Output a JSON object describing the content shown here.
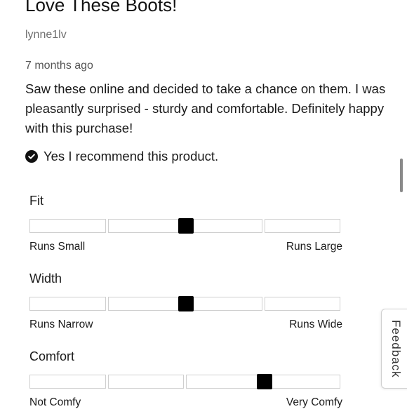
{
  "review": {
    "title": "Love These Boots!",
    "username": "lynne1lv",
    "timestamp": "7 months ago",
    "body": "Saw these online and decided to take a chance on them. I was pleasantly surprised - sturdy and comfortable. Definitely happy with this purchase!",
    "recommend_text": "Yes I recommend this product."
  },
  "ratings": [
    {
      "label": "Fit",
      "low": "Runs Small",
      "high": "Runs Large",
      "value_fraction": 0.5
    },
    {
      "label": "Width",
      "low": "Runs Narrow",
      "high": "Runs Wide",
      "value_fraction": 0.5
    },
    {
      "label": "Comfort",
      "low": "Not Comfy",
      "high": "Very Comfy",
      "value_fraction": 0.75
    }
  ],
  "feedback_tab": {
    "label": "Feedback"
  },
  "colors": {
    "marker": "#000000",
    "segment_border": "#cfcfcf",
    "muted_text": "#6f6f6f"
  }
}
